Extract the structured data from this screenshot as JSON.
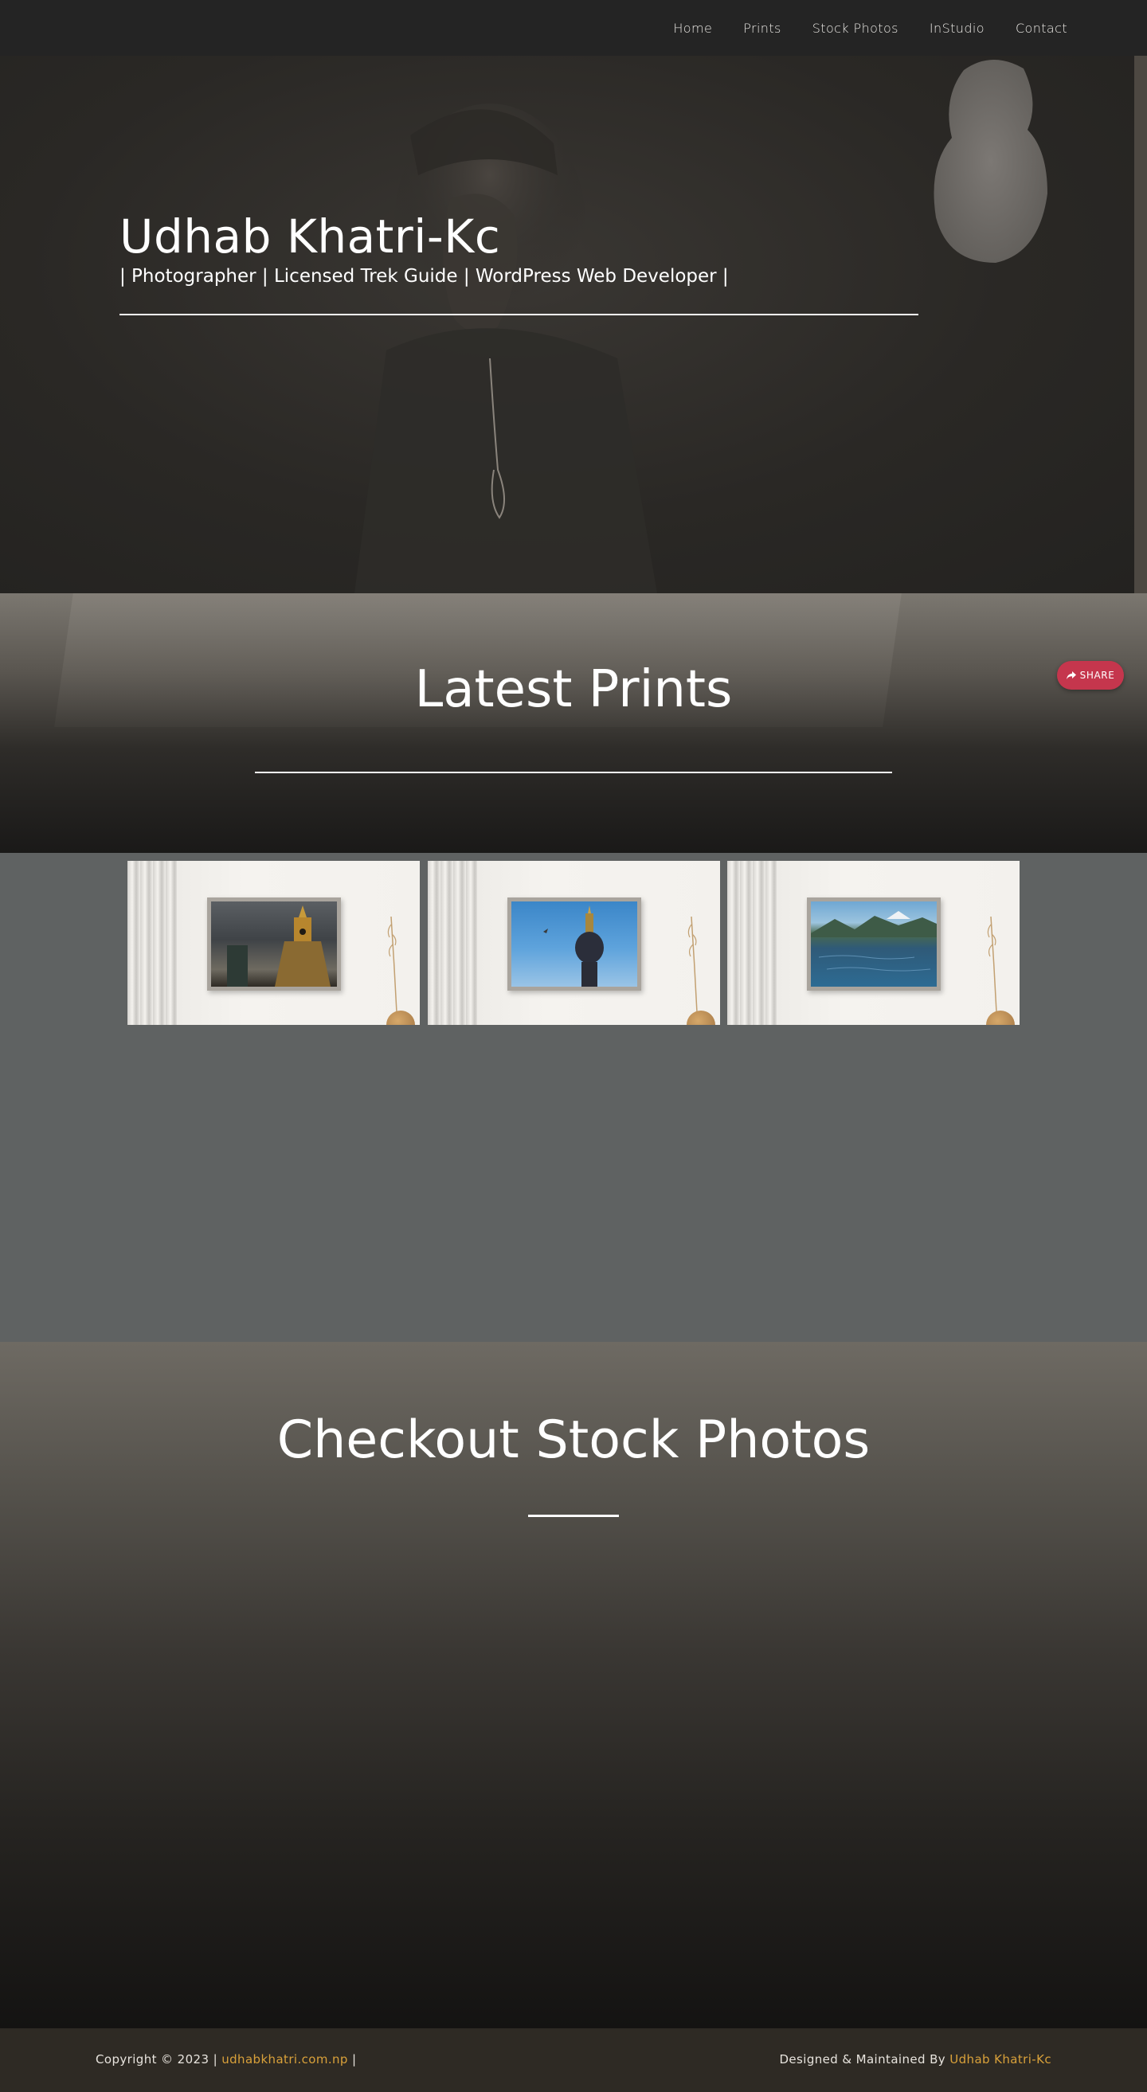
{
  "nav": {
    "items": [
      {
        "label": "Home"
      },
      {
        "label": "Prints"
      },
      {
        "label": "Stock Photos"
      },
      {
        "label": "InStudio"
      },
      {
        "label": "Contact"
      }
    ]
  },
  "hero": {
    "title": "Udhab Khatri-Kc",
    "subtitle": "| Photographer | Licensed Trek Guide | WordPress Web Developer |"
  },
  "prints": {
    "title": "Latest Prints",
    "items": [
      {
        "name": "stupa-print"
      },
      {
        "name": "pillar-print"
      },
      {
        "name": "lake-print"
      }
    ]
  },
  "share": {
    "label": "SHARE",
    "color": "#c5364d"
  },
  "stock": {
    "title": "Checkout Stock Photos"
  },
  "footer": {
    "copyright": "Copyright © 2023 |",
    "site_link": "udhabkhatri.com.np",
    "separator": "|",
    "designed_by": "Designed & Maintained By",
    "author_link": "Udhab Khatri-Kc",
    "link_color": "#d9a13a"
  }
}
